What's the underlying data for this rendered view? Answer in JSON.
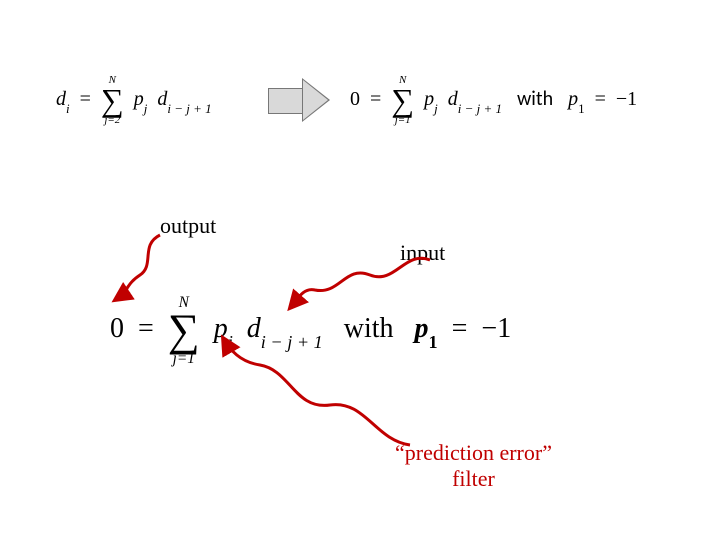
{
  "domain": "Diagram",
  "eq_top_left": {
    "lhs": "d",
    "lhs_sub": "i",
    "eq": "=",
    "sum_top": "N",
    "sum_bottom": "j=2",
    "term_p": "p",
    "term_p_sub": "j",
    "term_d": "d",
    "term_d_sub": "i − j + 1"
  },
  "eq_top_right": {
    "lhs": "0",
    "eq": "=",
    "sum_top": "N",
    "sum_bottom": "j=1",
    "term_p": "p",
    "term_p_sub": "j",
    "term_d": "d",
    "term_d_sub": "i − j + 1",
    "with": "with",
    "cond_lhs": "p",
    "cond_lhs_sub": "1",
    "cond_eq": "=",
    "cond_rhs": "−1"
  },
  "eq_main": {
    "lhs": "0",
    "eq": "=",
    "sum_top": "N",
    "sum_bottom": "j=1",
    "term_p": "p",
    "term_p_sub": "j",
    "term_d": "d",
    "term_d_sub": "i − j + 1",
    "with": "with",
    "cond_lhs": "p",
    "cond_lhs_sub": "1",
    "cond_eq": "=",
    "cond_rhs": "−1"
  },
  "labels": {
    "output": "output",
    "input": "input",
    "pred_line1": "“prediction error”",
    "pred_line2": "filter"
  }
}
